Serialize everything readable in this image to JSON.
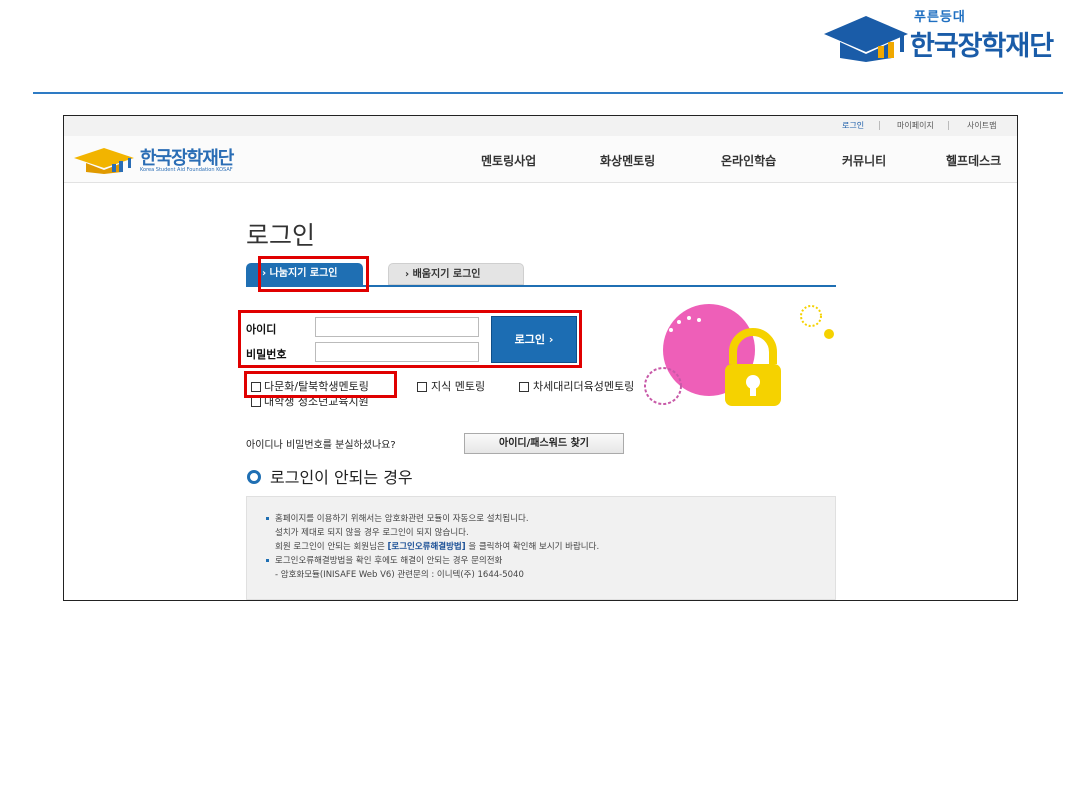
{
  "slide": {
    "logo_sub": "푸른등대",
    "logo_main": "한국장학재단"
  },
  "utility_nav": [
    "로그인",
    "마이페이지",
    "사이트맵"
  ],
  "site": {
    "logo_name": "한국장학재단",
    "logo_en": "Korea Student Aid Foundation KOSAF"
  },
  "gnb": [
    "멘토링사업",
    "화상멘토링",
    "온라인학습",
    "커뮤니티",
    "헬프데스크"
  ],
  "login": {
    "title": "로그인",
    "tabs": [
      "› 나눔지기 로그인",
      "› 배움지기 로그인"
    ],
    "id_label": "아이디",
    "id_value": "",
    "pw_label": "비밀번호",
    "pw_value": "",
    "button": "로그인 ›",
    "checkboxes": [
      "다문화/탈북학생멘토링",
      "지식 멘토링",
      "차세대리더육성멘토링",
      "대학생 청소년교육지원"
    ],
    "lost_text": "아이디나 비밀번호를 분실하셨나요?",
    "find_button": "아이디/패스워드 찾기"
  },
  "trouble": {
    "title": "로그인이 안되는 경우",
    "line1": "홈페이지를 이용하기 위해서는 암호화관련 모듈이 자동으로 설치됩니다.",
    "line2": "설치가 제대로 되지 않을 경우 로그인이 되지 않습니다.",
    "line3_pre": "회원 로그인이 안되는 회원님은 ",
    "line3_link": "[로그인오류해결방법]",
    "line3_post": " 을 클릭하여 확인해 보시기 바랍니다.",
    "line4": "로그인오류해결방법을 확인 후에도 해결이 안되는 경우 문의전화",
    "line5": "- 암호화모듈(INISAFE Web V6) 관련문의 : 이니텍(주) 1644-5040"
  },
  "colors": {
    "brand_blue": "#1f6fb3",
    "highlight_red": "#e00000"
  }
}
